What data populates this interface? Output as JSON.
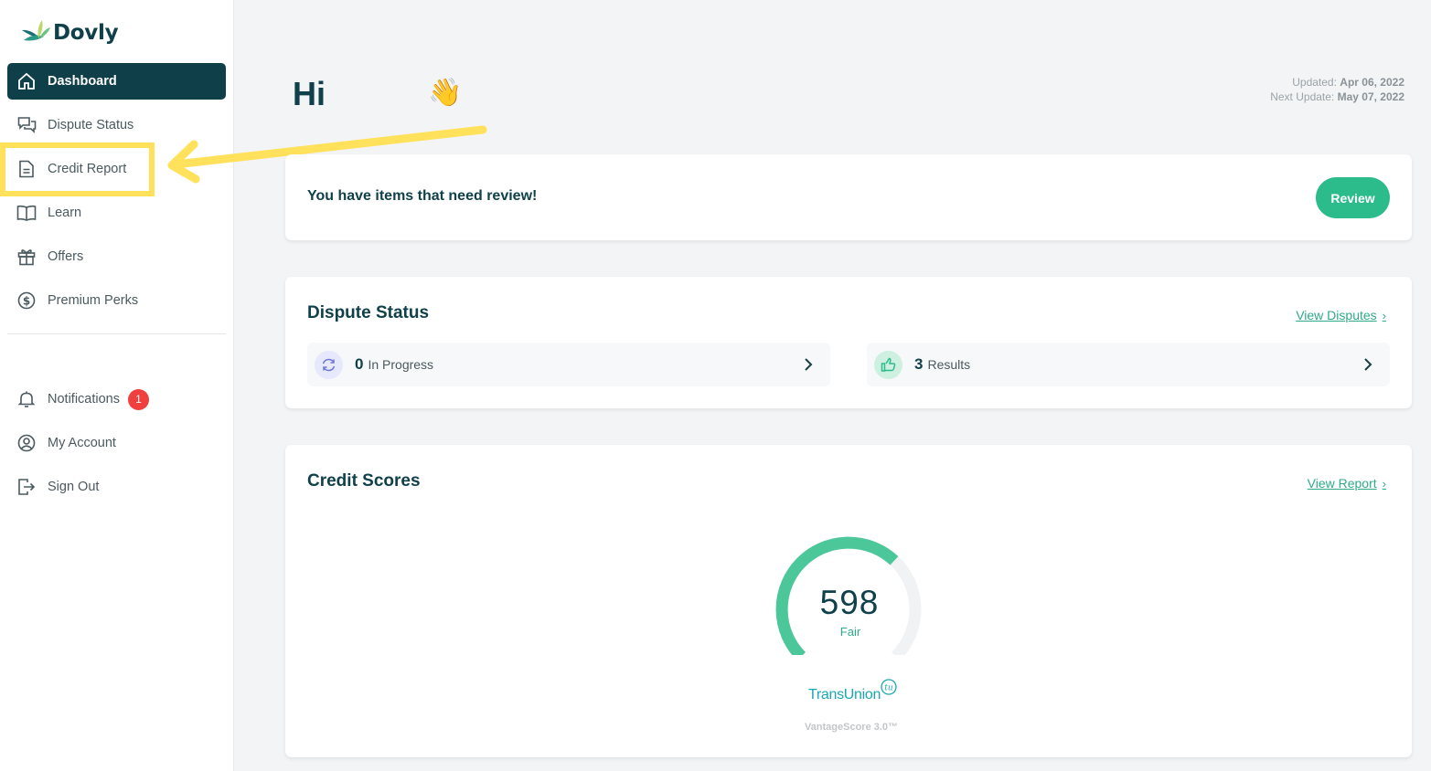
{
  "brand": {
    "name": "Dovly"
  },
  "sidebar": {
    "items": [
      {
        "label": "Dashboard",
        "icon": "home-icon",
        "active": true
      },
      {
        "label": "Dispute Status",
        "icon": "chat-bubbles-icon"
      },
      {
        "label": "Credit Report",
        "icon": "document-icon"
      },
      {
        "label": "Learn",
        "icon": "book-icon"
      },
      {
        "label": "Offers",
        "icon": "gift-icon"
      },
      {
        "label": "Premium Perks",
        "icon": "dollar-circle-icon"
      }
    ],
    "bottom_items": [
      {
        "label": "Notifications",
        "icon": "bell-icon",
        "badge": "1"
      },
      {
        "label": "My Account",
        "icon": "user-circle-icon"
      },
      {
        "label": "Sign Out",
        "icon": "sign-out-icon"
      }
    ]
  },
  "header": {
    "greeting": "Hi",
    "wave_emoji": "👋",
    "updated_label": "Updated:",
    "updated_value": "Apr 06, 2022",
    "next_update_label": "Next Update:",
    "next_update_value": "May 07, 2022"
  },
  "review_card": {
    "message": "You have items that need review!",
    "button_label": "Review"
  },
  "dispute_card": {
    "title": "Dispute Status",
    "link_label": "View Disputes",
    "in_progress": {
      "count": "0",
      "label": "In Progress"
    },
    "results": {
      "count": "3",
      "label": "Results"
    }
  },
  "credit_card": {
    "title": "Credit Scores",
    "link_label": "View Report",
    "score": "598",
    "score_fraction": 0.66,
    "rating": "Fair",
    "bureau": "TransUnion",
    "bureau_mark": "tu",
    "model": "VantageScore 3.0™"
  },
  "colors": {
    "sidebar_active": "#0f3f49",
    "accent_green": "#2cbb8a",
    "highlight_yellow": "#ffe15c",
    "badge_red": "#ef3f3f",
    "transunion_teal": "#1aa7b3"
  }
}
